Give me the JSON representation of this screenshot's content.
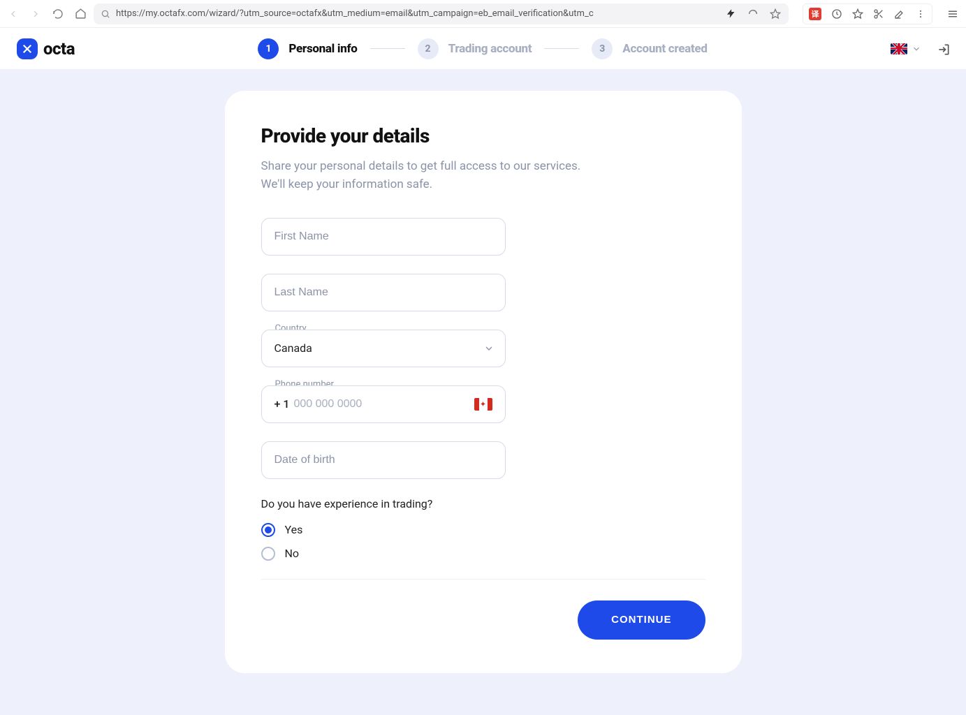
{
  "browser": {
    "url": "https://my.octafx.com/wizard/?utm_source=octafx&utm_medium=email&utm_campaign=eb_email_verification&utm_c",
    "translate_badge": "译"
  },
  "header": {
    "brand": "octa",
    "steps": [
      {
        "num": "1",
        "label": "Personal info"
      },
      {
        "num": "2",
        "label": "Trading account"
      },
      {
        "num": "3",
        "label": "Account created"
      }
    ]
  },
  "form": {
    "title": "Provide your details",
    "subtitle_line1": "Share your personal details to get full access to our services.",
    "subtitle_line2": "We'll keep your information safe.",
    "first_name_placeholder": "First Name",
    "last_name_placeholder": "Last Name",
    "country_label": "Country",
    "country_value": "Canada",
    "phone_label": "Phone number",
    "phone_prefix": "+ 1",
    "phone_placeholder": "000 000 0000",
    "dob_placeholder": "Date of birth",
    "experience_question": "Do you have experience in trading?",
    "option_yes": "Yes",
    "option_no": "No",
    "continue_label": "CONTINUE"
  }
}
